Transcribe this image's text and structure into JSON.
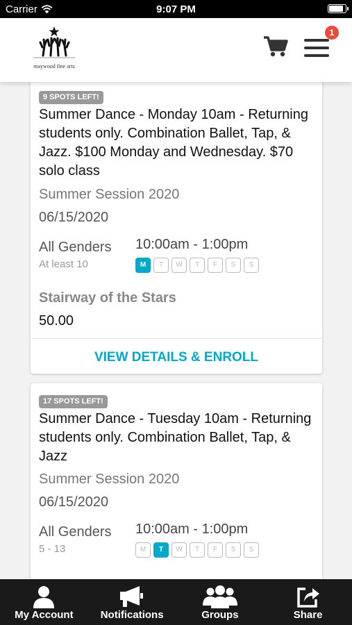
{
  "status_bar": {
    "carrier": "Carrier",
    "time": "9:07 PM",
    "battery_level": 0.9
  },
  "header": {
    "logo_text": "maywood fine arts",
    "cart_icon": "cart-icon",
    "menu_icon": "hamburger-menu-icon",
    "notification_badge": "1"
  },
  "classes": [
    {
      "spots": "9 SPOTS LEFT!",
      "title": "Summer Dance - Monday 10am - Returning students only. Combination Ballet, Tap, & Jazz. $100 Monday and Wednesday. $70 solo class",
      "session": "Summer Session 2020",
      "date": "06/15/2020",
      "gender": "All Genders",
      "age": "At least 10",
      "time": "10:00am - 1:00pm",
      "days": [
        "M",
        "T",
        "W",
        "T",
        "F",
        "S",
        "S"
      ],
      "active_day_index": 0,
      "location": "Stairway of the Stars",
      "price": "50.00",
      "action_label": "VIEW DETAILS & ENROLL"
    },
    {
      "spots": "17 SPOTS LEFT!",
      "title": "Summer Dance - Tuesday 10am - Returning students only. Combination Ballet, Tap, & Jazz",
      "session": "Summer Session 2020",
      "date": "06/15/2020",
      "gender": "All Genders",
      "age": "5 - 13",
      "time": "10:00am - 1:00pm",
      "days": [
        "M",
        "T",
        "W",
        "T",
        "F",
        "S",
        "S"
      ],
      "active_day_index": 1
    }
  ],
  "tab_bar": [
    {
      "label": "My Account",
      "icon": "person-icon"
    },
    {
      "label": "Notifications",
      "icon": "megaphone-icon"
    },
    {
      "label": "Groups",
      "icon": "group-icon"
    },
    {
      "label": "Share",
      "icon": "share-icon"
    }
  ],
  "colors": {
    "accent": "#00a9c9",
    "badge": "#e74c3c",
    "tab_bar": "#1a1a1a",
    "spots_badge": "#999999"
  }
}
